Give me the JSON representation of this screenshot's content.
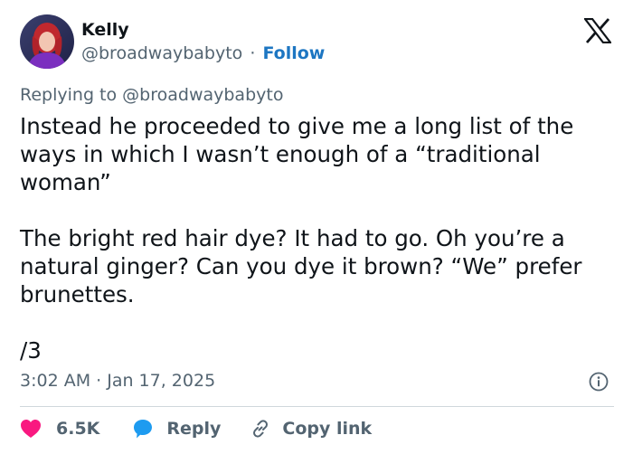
{
  "author": {
    "name": "Kelly",
    "handle": "@broadwaybabyto",
    "separator": "·",
    "follow_label": "Follow"
  },
  "reply_context": {
    "prefix": "Replying to ",
    "mention": "@broadwaybabyto"
  },
  "post": {
    "paragraph1": "Instead he proceeded to give me a long list of the ways in which I wasn’t enough of a “traditional woman”",
    "paragraph2": "The bright red hair dye? It had to go. Oh you’re a natural ginger? Can you dye it brown? “We” prefer brunettes.",
    "paragraph3": "/3"
  },
  "timestamp": "3:02 AM · Jan 17, 2025",
  "actions": {
    "like_count": "6.5K",
    "reply_label": "Reply",
    "copy_link_label": "Copy link"
  },
  "colors": {
    "follow_blue": "#1d76c2",
    "like_red": "#f91880",
    "reply_blue": "#1d9bf0",
    "secondary_text": "#536471",
    "primary_text": "#0f1419"
  },
  "icons": {
    "brand": "x-logo-icon",
    "info": "info-icon",
    "like": "heart-icon",
    "reply": "speech-bubble-icon",
    "copy": "link-icon"
  }
}
